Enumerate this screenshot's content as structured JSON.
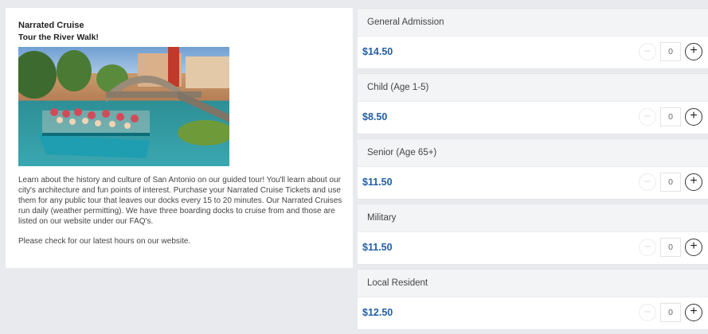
{
  "product": {
    "title": "Narrated Cruise",
    "subtitle": "Tour the River Walk!",
    "description": "Learn about the history and culture of San Antonio on our guided tour! You'll learn about our city's architecture and fun points of interest. Purchase your Narrated Cruise Tickets and use them for any public tour that leaves our docks every 15 to 20 minutes. Our Narrated Cruises run daily (weather permitting). We have three boarding docks to cruise from and those are listed on our website under our FAQ's.",
    "hours_note": "Please check for our latest hours on our website."
  },
  "tickets": [
    {
      "name": "General Admission",
      "price": "$14.50",
      "quantity": "0"
    },
    {
      "name": "Child (Age 1-5)",
      "price": "$8.50",
      "quantity": "0"
    },
    {
      "name": "Senior (Age 65+)",
      "price": "$11.50",
      "quantity": "0"
    },
    {
      "name": "Military",
      "price": "$11.50",
      "quantity": "0"
    },
    {
      "name": "Local Resident",
      "price": "$12.50",
      "quantity": "0"
    }
  ],
  "controls": {
    "minus_symbol": "−",
    "plus_symbol": "+"
  },
  "colors": {
    "price": "#1f5fa8",
    "panel": "#ffffff",
    "background": "#e9eaee"
  }
}
